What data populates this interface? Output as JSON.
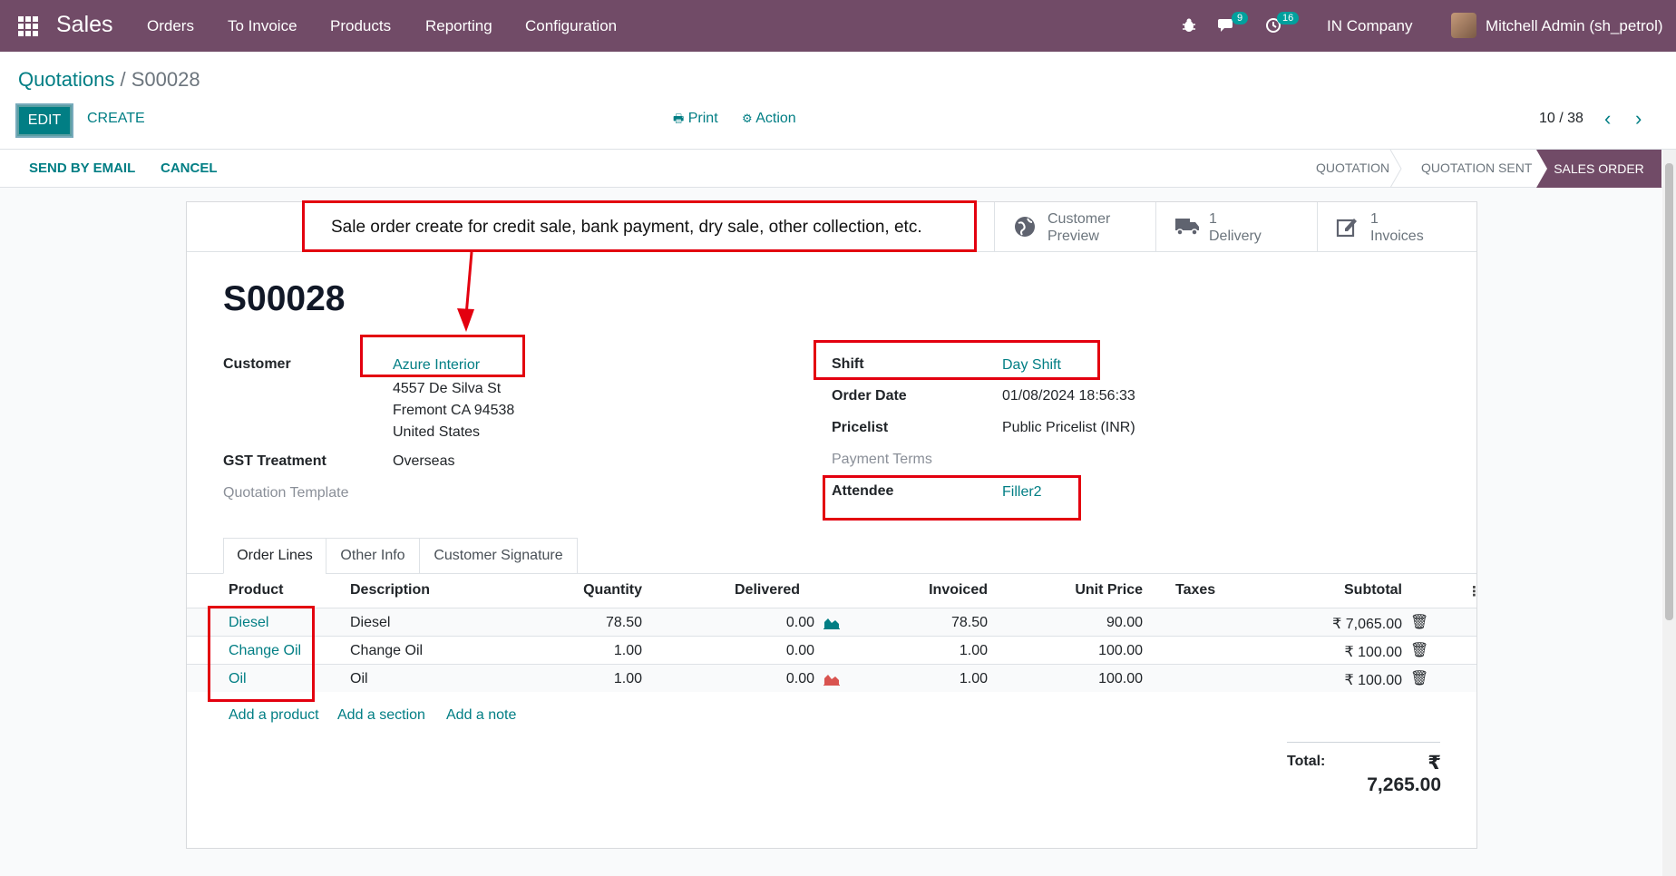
{
  "navbar": {
    "app_name": "Sales",
    "menu": [
      "Orders",
      "To Invoice",
      "Products",
      "Reporting",
      "Configuration"
    ],
    "chat_badge": "9",
    "activity_badge": "16",
    "company": "IN Company",
    "user": "Mitchell Admin (sh_petrol)",
    "icons": [
      "apps-grid-icon",
      "bug-icon",
      "chat-icon",
      "clock-icon"
    ]
  },
  "control": {
    "breadcrumb_parent": "Quotations",
    "breadcrumb_sep": " / ",
    "breadcrumb_current": "S00028",
    "edit_label": "EDIT",
    "create_label": "CREATE",
    "print_label": "Print",
    "action_label": "Action",
    "pager": "10 / 38"
  },
  "statusbar": {
    "send_label": "SEND BY EMAIL",
    "cancel_label": "CANCEL",
    "stages": [
      "QUOTATION",
      "QUOTATION SENT",
      "SALES ORDER"
    ],
    "active_stage": "SALES ORDER"
  },
  "annotation": {
    "callout": "Sale order create for credit sale, bank payment, dry sale, other collection, etc.",
    "color": "#e3000f"
  },
  "smart_buttons": [
    {
      "line1": "Customer",
      "line2": "Preview",
      "icon": "globe-icon"
    },
    {
      "line1": "1",
      "line2": "Delivery",
      "icon": "truck-icon"
    },
    {
      "line1": "1",
      "line2": "Invoices",
      "icon": "pencil-square-icon"
    }
  ],
  "order": {
    "name": "S00028",
    "customer_label": "Customer",
    "customer": "Azure Interior",
    "address": [
      "4557 De Silva St",
      "Fremont CA 94538",
      "United States"
    ],
    "gst_label": "GST Treatment",
    "gst": "Overseas",
    "template_label": "Quotation Template",
    "shift_label": "Shift",
    "shift": "Day Shift",
    "order_date_label": "Order Date",
    "order_date": "01/08/2024 18:56:33",
    "pricelist_label": "Pricelist",
    "pricelist": "Public Pricelist (INR)",
    "payment_terms_label": "Payment Terms",
    "attendee_label": "Attendee",
    "attendee": "Filler2"
  },
  "tabs": [
    "Order Lines",
    "Other Info",
    "Customer Signature"
  ],
  "table": {
    "headers": [
      "Product",
      "Description",
      "Quantity",
      "Delivered",
      "Invoiced",
      "Unit Price",
      "Taxes",
      "Subtotal"
    ],
    "rows": [
      {
        "product": "Diesel",
        "description": "Diesel",
        "quantity": "78.50",
        "delivered": "0.00",
        "invoiced": "78.50",
        "unit_price": "90.00",
        "taxes": "",
        "subtotal": "₹ 7,065.00",
        "chart": "teal"
      },
      {
        "product": "Change Oil",
        "description": "Change Oil",
        "quantity": "1.00",
        "delivered": "0.00",
        "invoiced": "1.00",
        "unit_price": "100.00",
        "taxes": "",
        "subtotal": "₹ 100.00",
        "chart": ""
      },
      {
        "product": "Oil",
        "description": "Oil",
        "quantity": "1.00",
        "delivered": "0.00",
        "invoiced": "1.00",
        "unit_price": "100.00",
        "taxes": "",
        "subtotal": "₹ 100.00",
        "chart": "red"
      }
    ],
    "add_product": "Add a product",
    "add_section": "Add a section",
    "add_note": "Add a note"
  },
  "total": {
    "label": "Total:",
    "value": "₹ 7,265.00"
  },
  "colors": {
    "brand": "#714b67",
    "link": "#017e84",
    "chart_ok": "#017e84",
    "chart_warn": "#d9534f"
  }
}
